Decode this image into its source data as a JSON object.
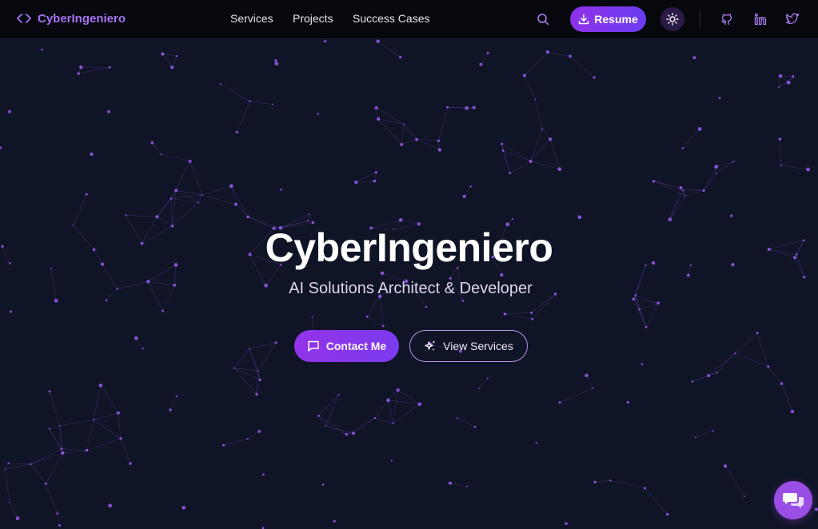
{
  "header": {
    "logo_text": "CyberIngeniero",
    "nav": [
      "Services",
      "Projects",
      "Success Cases"
    ],
    "resume_label": "Resume",
    "icons": {
      "logo": "code-brackets-icon",
      "search": "search-icon",
      "resume": "download-icon",
      "theme": "sun-icon",
      "github": "github-icon",
      "linkedin": "linkedin-icon",
      "twitter": "twitter-icon"
    }
  },
  "hero": {
    "title": "CyberIngeniero",
    "subtitle": "AI Solutions Architect & Developer",
    "contact_label": "Contact Me",
    "services_label": "View Services",
    "icons": {
      "contact": "message-square-icon",
      "services": "sparkles-icon"
    }
  },
  "chat": {
    "icon": "chat-bubbles-icon"
  },
  "colors": {
    "background": "#0f1426",
    "navbar": "#06080d",
    "accent": "#9333ea",
    "accent_secondary": "#6b3df0",
    "logo_text": "#a671f2",
    "particle": "#9b5cf0"
  }
}
